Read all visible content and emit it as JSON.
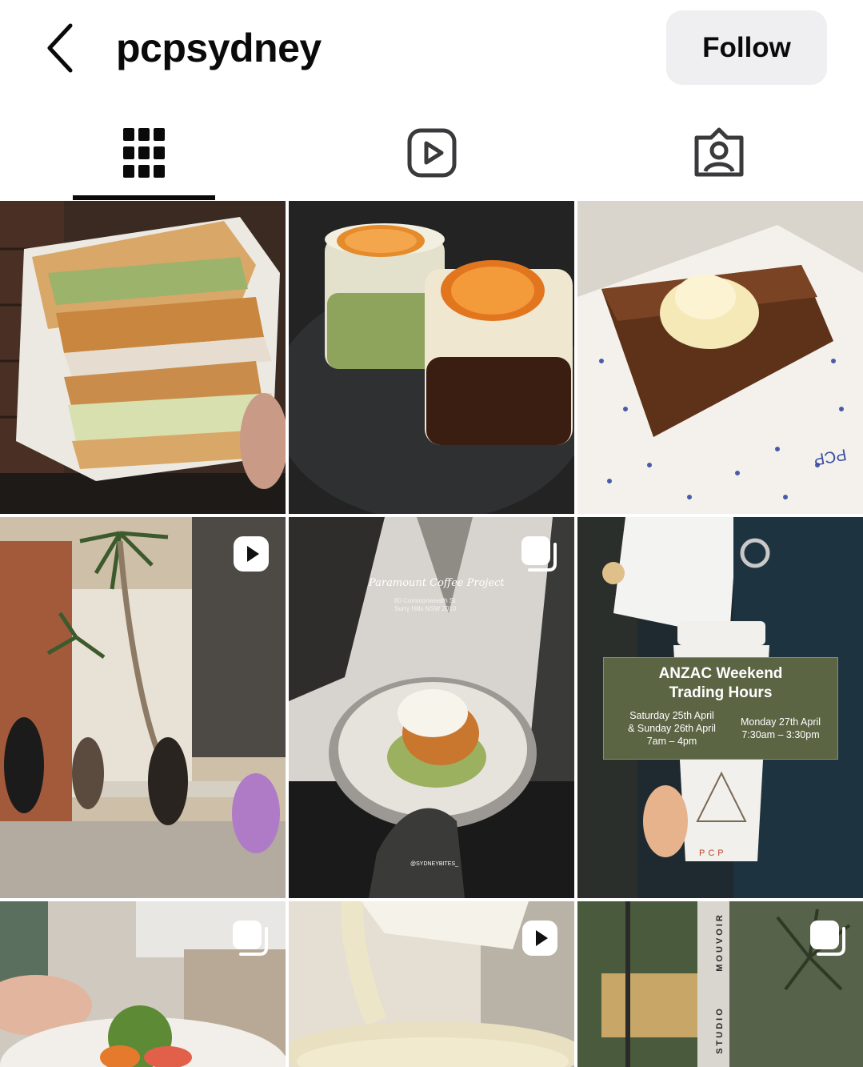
{
  "header": {
    "username": "pcpsydney",
    "follow_label": "Follow",
    "back_icon": "chevron-left-icon"
  },
  "tabs": [
    {
      "name": "posts",
      "icon": "grid-icon",
      "active": true
    },
    {
      "name": "reels",
      "icon": "reels-icon",
      "active": false
    },
    {
      "name": "tagged",
      "icon": "tagged-person-icon",
      "active": false
    }
  ],
  "posts": [
    {
      "subject": "sandwich",
      "badge": null
    },
    {
      "subject": "matcha and coffee drinks with dried orange",
      "badge": null
    },
    {
      "subject": "banana bread with butter",
      "badge": null,
      "napkin_text": "PCP"
    },
    {
      "subject": "cafe street view with palm tree",
      "badge": "reel-icon"
    },
    {
      "subject": "plated dessert",
      "badge": "carousel-icon",
      "caption_title": "Paramount Coffee Project",
      "caption_address_1": "80 Commonwealth St",
      "caption_address_2": "Surry Hills NSW 2010",
      "caption_credit": "@SYDNEYBITES_"
    },
    {
      "subject": "coffee cup with trading hours",
      "badge": null,
      "card_title_1": "ANZAC Weekend",
      "card_title_2": "Trading Hours",
      "left_1": "Saturday 25th April",
      "left_2": "& Sunday 26th April",
      "left_3": "7am – 4pm",
      "right_1": "Monday 27th April",
      "right_2": "7:30am – 3:30pm",
      "cup_logo": "PCP"
    },
    {
      "subject": "salad plate",
      "badge": "carousel-icon"
    },
    {
      "subject": "pouring cream",
      "badge": "reel-icon"
    },
    {
      "subject": "storefront",
      "badge": "carousel-icon",
      "sign_text_1": "MOUVOIR",
      "sign_text_2": "STUDIO"
    }
  ],
  "colors": {
    "follow_bg": "#efeff1",
    "text": "#0a0a0a",
    "card_green": "#5b6443"
  }
}
